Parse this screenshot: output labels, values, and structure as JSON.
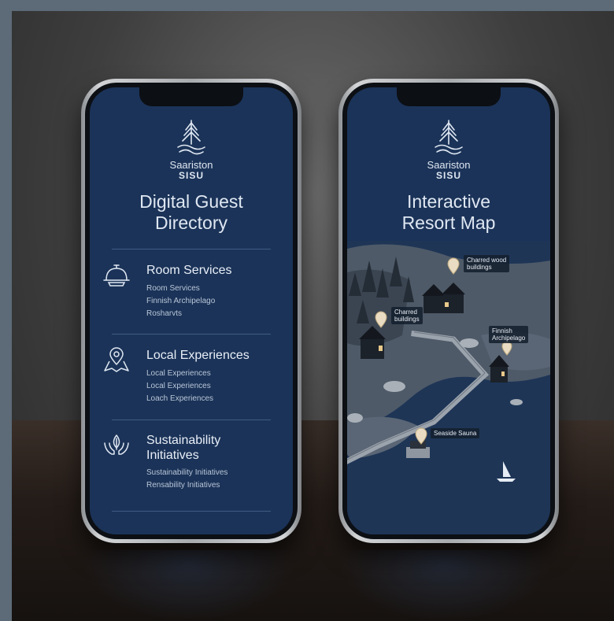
{
  "left_phone": {
    "brand_line1": "Saariston",
    "brand_line2": "SISU",
    "title_line1": "Digital Guest",
    "title_line2": "Directory",
    "sections": [
      {
        "heading": "Room Services",
        "items": [
          "Room Services",
          "Finnish Archipelago",
          "Rosharvts"
        ],
        "icon": "room-service-bell-icon"
      },
      {
        "heading": "Local Experiences",
        "items": [
          "Local Experiences",
          "Local Experiences",
          "Loach Experiences"
        ],
        "icon": "map-location-pin-icon"
      },
      {
        "heading_line1": "Sustainability",
        "heading_line2": "Initiatives",
        "items": [
          "Sustainability Initiatives",
          "Rensability Initiatives"
        ],
        "icon": "leaf-hands-icon"
      }
    ]
  },
  "right_phone": {
    "brand_line1": "Saariston",
    "brand_line2": "SISU",
    "title_line1": "Interactive",
    "title_line2": "Resort Map",
    "map_labels": {
      "charred_wood_line1": "Charred wood",
      "charred_wood_line2": "buildings",
      "charred_line1": "Charred",
      "charred_line2": "buildings",
      "finnish_line1": "Finnish",
      "finnish_line2": "Archipelago",
      "sauna": "Seaside Sauna"
    }
  },
  "colors": {
    "screen_bg": "#1b3358",
    "text": "#dfe7f2",
    "divider": "#3f5a82",
    "pin": "#e9dcc2"
  }
}
